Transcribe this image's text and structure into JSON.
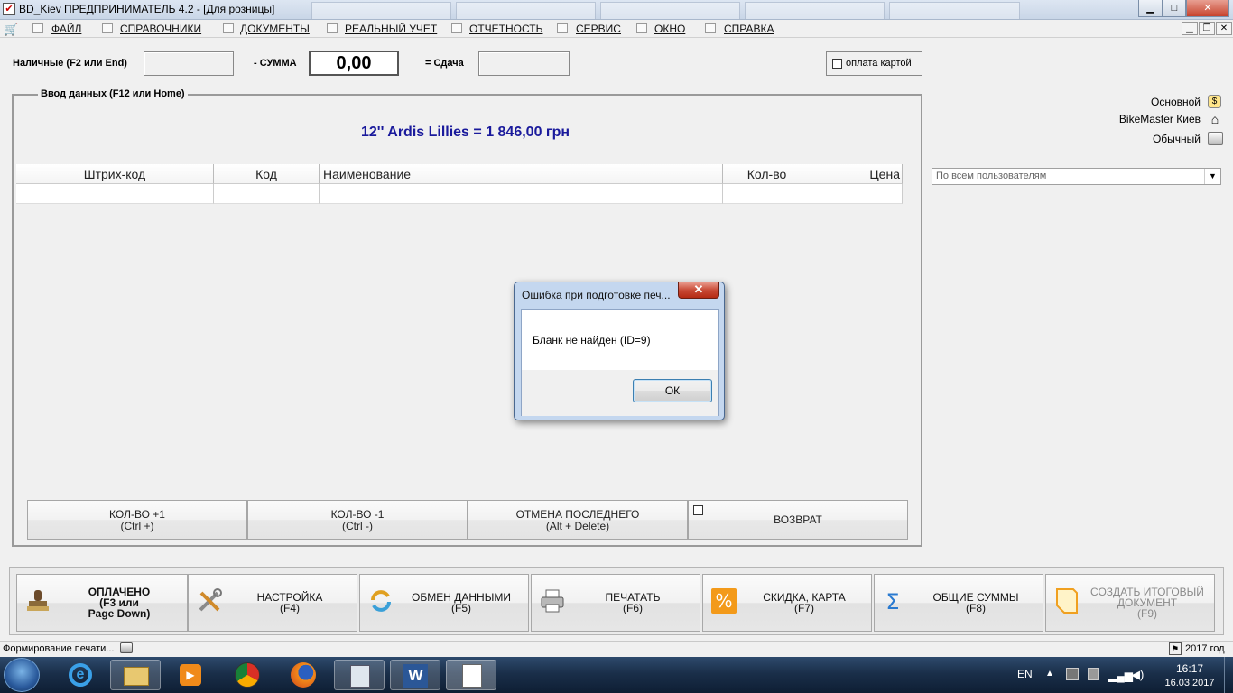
{
  "window": {
    "title": "BD_Kiev  ПРЕДПРИНИМАТЕЛЬ 4.2 - [Для розницы]",
    "minimize": "▁",
    "maximize": "□",
    "close": "✕"
  },
  "menu": {
    "items": [
      "ФАЙЛ",
      "СПРАВОЧНИКИ",
      "ДОКУМЕНТЫ",
      "РЕАЛЬНЫЙ УЧЕТ",
      "ОТЧЕТНОСТЬ",
      "СЕРВИС",
      "ОКНО",
      "СПРАВКА"
    ]
  },
  "payment": {
    "cash_label": "Наличные (F2 или End)",
    "cash_value": "",
    "sum_label": "- СУММА",
    "sum_value": "0,00",
    "change_label": "= Сдача",
    "change_value": "",
    "card_label": "оплата картой",
    "card_checked": false
  },
  "input_group": {
    "label": "Ввод данных (F12 или Home)",
    "item_line": "12'' Ardis Lillies   = 1 846,00 грн"
  },
  "grid": {
    "columns": [
      "Штрих-код",
      "Код",
      "Наименование",
      "Кол-во",
      "Цена"
    ],
    "rows": [
      [
        "",
        "",
        "",
        "",
        ""
      ]
    ]
  },
  "right_panel": {
    "price_type": "Основной",
    "store": "BikeMaster Киев",
    "print_mode": "Обычный",
    "user_filter": "По всем пользователям"
  },
  "action_buttons": [
    {
      "line1": "КОЛ-ВО +1",
      "line2": "(Ctrl +)"
    },
    {
      "line1": "КОЛ-ВО -1",
      "line2": "(Ctrl -)"
    },
    {
      "line1": "ОТМЕНА ПОСЛЕДНЕГО",
      "line2": "(Alt + Delete)"
    },
    {
      "line1": "ВОЗВРАТ",
      "line2": ""
    }
  ],
  "toolbar": {
    "paid": {
      "line1": "ОПЛАЧЕНО",
      "line2": "(F3 или",
      "line3": "Page Down)"
    },
    "settings": {
      "line1": "НАСТРОЙКА",
      "line2": "(F4)"
    },
    "exchange": {
      "line1": "ОБМЕН ДАННЫМИ",
      "line2": "(F5)"
    },
    "print": {
      "line1": "ПЕЧАТАТЬ",
      "line2": "(F6)"
    },
    "discount": {
      "line1": "СКИДКА, КАРТА",
      "line2": "(F7)"
    },
    "totals": {
      "line1": "ОБЩИЕ СУММЫ",
      "line2": "(F8)"
    },
    "final_doc": {
      "line1": "СОЗДАТЬ ИТОГОВЫЙ",
      "line2": "ДОКУМЕНТ",
      "line3": "(F9)"
    }
  },
  "status": {
    "left": "Формирование печати...",
    "right": "2017 год"
  },
  "dialog": {
    "title": "Ошибка при подготовке печ...",
    "message": "Бланк не найден (ID=9)",
    "ok": "ОК",
    "close": "✕"
  },
  "taskbar": {
    "lang": "EN",
    "time": "16:17",
    "date": "16.03.2017"
  },
  "colors": {
    "item_line": "#1a1a9c",
    "taskbar": "#1a2f4a",
    "dialog_frame": "#c4d7ef"
  }
}
